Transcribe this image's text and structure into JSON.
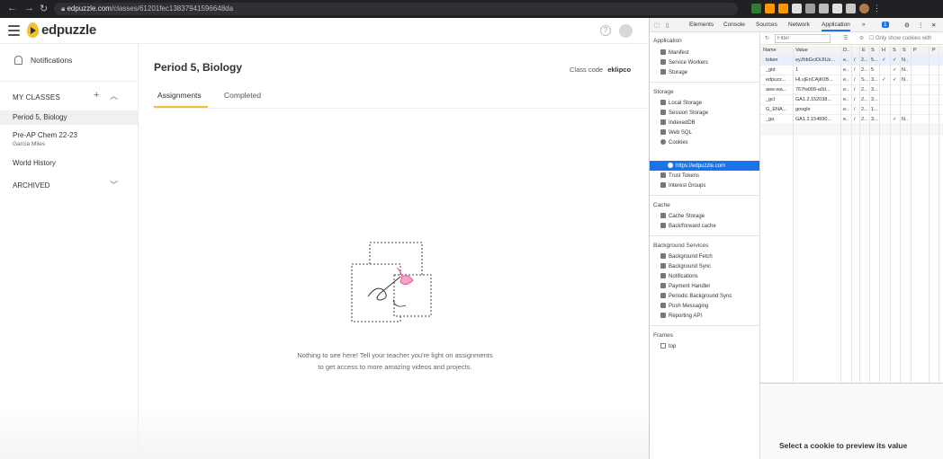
{
  "browser": {
    "url_domain": "edpuzzle.com",
    "url_path": "/classes/61201fec13837941596648da"
  },
  "header": {
    "brand": "edpuzzle",
    "help": "?"
  },
  "sidebar": {
    "notifications": "Notifications",
    "my_classes": "MY CLASSES",
    "add": "+",
    "classes": [
      {
        "name": "Period 5, Biology",
        "teacher": ""
      },
      {
        "name": "Pre-AP Chem 22-23",
        "teacher": "Garcia Miles"
      },
      {
        "name": "World History",
        "teacher": ""
      }
    ],
    "archived": "ARCHIVED"
  },
  "main": {
    "title": "Period 5, Biology",
    "class_code_label": "Class code",
    "class_code": "eklipco",
    "tabs": [
      "Assignments",
      "Completed"
    ],
    "empty_line1": "Nothing to see here! Tell your teacher you're light on assignments",
    "empty_line2": "to get access to more amazing videos and projects."
  },
  "devtools": {
    "tabs": [
      "Elements",
      "Console",
      "Sources",
      "Network",
      "Application",
      "»"
    ],
    "filter_placeholder": "Filter",
    "only_show": "Only show cookies with",
    "app_head": "Application",
    "app_items": [
      "Manifest",
      "Service Workers",
      "Storage"
    ],
    "storage_head": "Storage",
    "storage_items": [
      "Local Storage",
      "Session Storage",
      "IndexedDB",
      "Web SQL",
      "Cookies"
    ],
    "cookie_origin": "https://edpuzzle.com",
    "storage_items2": [
      "Trust Tokens",
      "Interest Groups"
    ],
    "cache_head": "Cache",
    "cache_items": [
      "Cache Storage",
      "Back/forward cache"
    ],
    "bg_head": "Background Services",
    "bg_items": [
      "Background Fetch",
      "Background Sync",
      "Notifications",
      "Payment Handler",
      "Periodic Background Sync",
      "Push Messaging",
      "Reporting API"
    ],
    "frames_head": "Frames",
    "frames_top": "top",
    "columns": [
      "Name",
      "Value",
      "D..",
      "/",
      "E",
      "S",
      "H",
      "S",
      "S",
      "P",
      "P"
    ],
    "rows": [
      {
        "name": "token",
        "value": "eyJhbGciOiJIUz...",
        "d": "e..",
        "p": "/",
        "e": "2...",
        "s": "5...",
        "h": "✓",
        "s2": "✓",
        "ss": "N..",
        "p1": "",
        "p2": ""
      },
      {
        "name": "_gid",
        "value": "1",
        "d": "e..",
        "p": "/",
        "e": "2...",
        "s": "5",
        "h": "",
        "s2": "✓",
        "ss": "N..",
        "p1": "",
        "p2": ""
      },
      {
        "name": "edpuzz...",
        "value": "HLvjEnCAjK0B...",
        "d": "e..",
        "p": "/",
        "e": "S...",
        "s": "3...",
        "h": "✓",
        "s2": "✓",
        "ss": "N..",
        "p1": "",
        "p2": ""
      },
      {
        "name": "aws-wa...",
        "value": "767fa009-a0d...",
        "d": "e..",
        "p": "/",
        "e": "2...",
        "s": "3...",
        "h": "",
        "s2": "",
        "ss": "",
        "p1": "",
        "p2": ""
      },
      {
        "name": "_gcl",
        "value": "GA1.2.152038...",
        "d": "e..",
        "p": "/",
        "e": "2...",
        "s": "3...",
        "h": "",
        "s2": "",
        "ss": "",
        "p1": "",
        "p2": ""
      },
      {
        "name": "G_ENA...",
        "value": "google",
        "d": "e..",
        "p": "/",
        "e": "2...",
        "s": "1...",
        "h": "",
        "s2": "",
        "ss": "",
        "p1": "",
        "p2": ""
      },
      {
        "name": "_ga",
        "value": "GA1.2.154890...",
        "d": "e..",
        "p": "/",
        "e": "2...",
        "s": "3...",
        "h": "",
        "s2": "✓",
        "ss": "N..",
        "p1": "",
        "p2": ""
      }
    ],
    "preview_hint": "Select a cookie to preview its value"
  }
}
